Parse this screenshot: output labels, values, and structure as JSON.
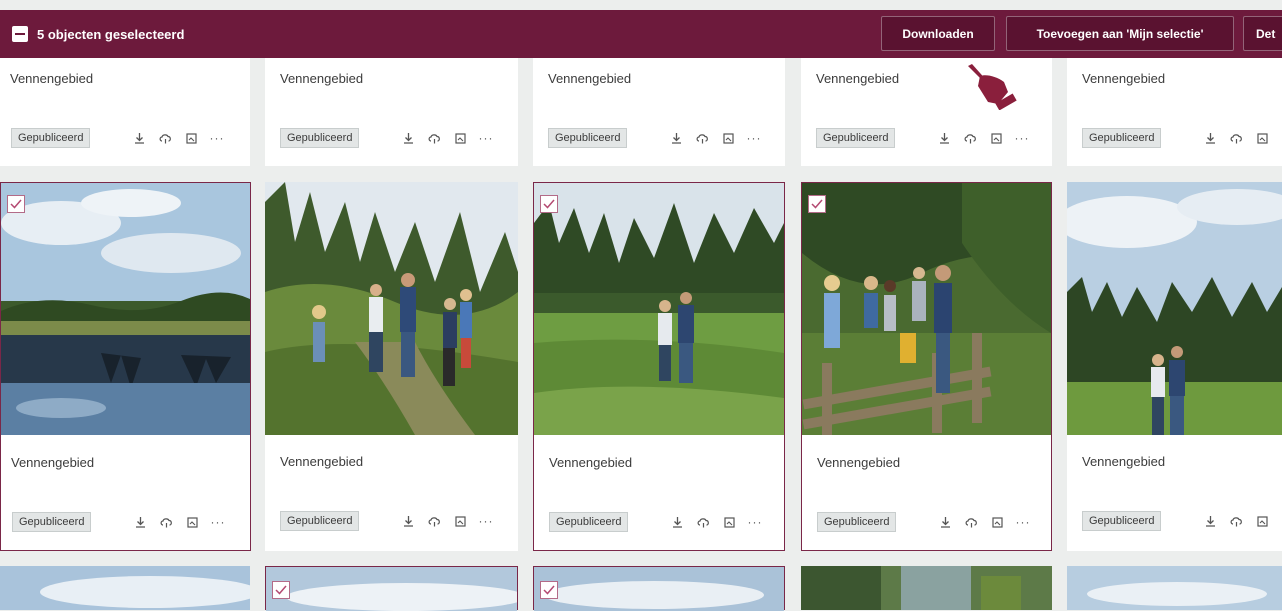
{
  "toolbar": {
    "selected_count": "5 objecten geselecteerd",
    "download_label": "Downloaden",
    "add_to_selection_label": "Toevoegen aan 'Mijn selectie'",
    "more_label": "Det"
  },
  "cards": {
    "top": [
      {
        "title": "Vennengebied",
        "status": "Gepubliceerd"
      },
      {
        "title": "Vennengebied",
        "status": "Gepubliceerd"
      },
      {
        "title": "Vennengebied",
        "status": "Gepubliceerd"
      },
      {
        "title": "Vennengebied",
        "status": "Gepubliceerd"
      },
      {
        "title": "Vennengebied",
        "status": "Gepubliceerd"
      }
    ],
    "middle": [
      {
        "title": "Vennengebied",
        "status": "Gepubliceerd",
        "selected": true,
        "photo": "lake-reflection"
      },
      {
        "title": "Vennengebied",
        "status": "Gepubliceerd",
        "selected": false,
        "photo": "family-walking-path"
      },
      {
        "title": "Vennengebied",
        "status": "Gepubliceerd",
        "selected": true,
        "photo": "couple-in-meadow"
      },
      {
        "title": "Vennengebied",
        "status": "Gepubliceerd",
        "selected": true,
        "photo": "family-on-fence"
      },
      {
        "title": "Vennengebied",
        "status": "Gepubliceerd",
        "selected": false,
        "photo": "couple-by-forest"
      }
    ],
    "bottom": [
      {
        "selected": false
      },
      {
        "selected": true
      },
      {
        "selected": true
      },
      {
        "selected": false
      },
      {
        "selected": false
      }
    ]
  },
  "icons": [
    "download-icon",
    "cloud-icon",
    "image-icon",
    "more-icon",
    "check-icon",
    "hand-pointer-icon"
  ],
  "colors": {
    "accent": "#6d1a3c",
    "selected_border": "#7a2748",
    "background": "#eceeed"
  }
}
